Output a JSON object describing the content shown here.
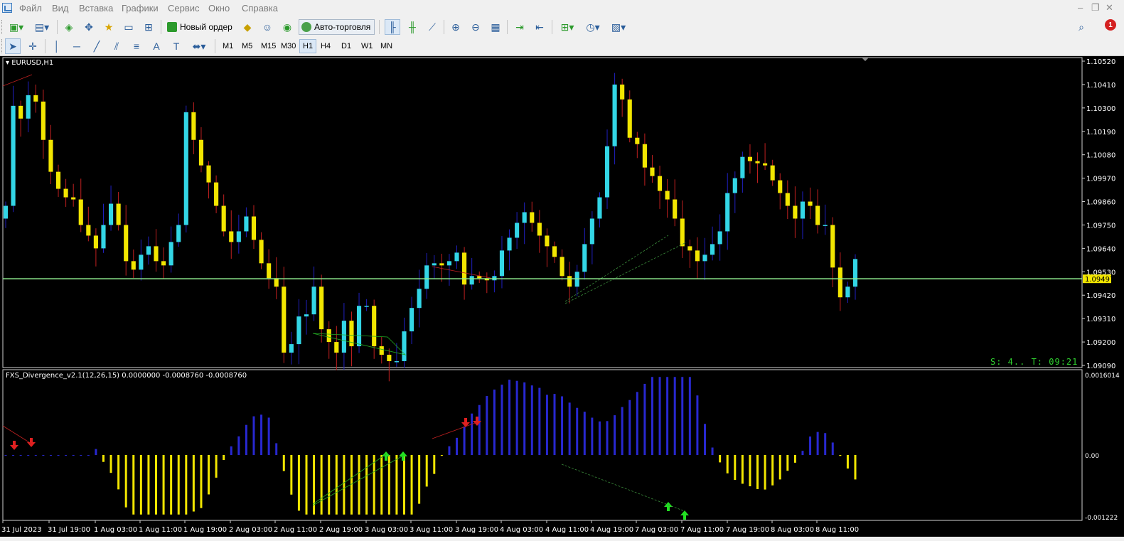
{
  "menu": {
    "items": [
      "Файл",
      "Вид",
      "Вставка",
      "Графики",
      "Сервис",
      "Окно",
      "Справка"
    ]
  },
  "toolbar": {
    "new_order_label": "Новый ордер",
    "autotrading_label": "Авто-торговля"
  },
  "timeframes": [
    "M1",
    "M5",
    "M15",
    "M30",
    "H1",
    "H4",
    "D1",
    "W1",
    "MN"
  ],
  "active_timeframe": "H1",
  "alerts": {
    "count": "1"
  },
  "chart": {
    "symbol_title": "EURUSD,H1",
    "current_price": "1.09497",
    "timer_text": "S: 4.. T: 09:21",
    "price_axis": [
      "1.10520",
      "1.10410",
      "1.10300",
      "1.10190",
      "1.10080",
      "1.09970",
      "1.09860",
      "1.09750",
      "1.09640",
      "1.09530",
      "1.09420",
      "1.09310",
      "1.09200",
      "1.09090"
    ],
    "time_axis": [
      "31 Jul 2023",
      "31 Jul 19:00",
      "1 Aug 03:00",
      "1 Aug 11:00",
      "1 Aug 19:00",
      "2 Aug 03:00",
      "2 Aug 11:00",
      "2 Aug 19:00",
      "3 Aug 03:00",
      "3 Aug 11:00",
      "3 Aug 19:00",
      "4 Aug 03:00",
      "4 Aug 11:00",
      "4 Aug 19:00",
      "7 Aug 03:00",
      "7 Aug 11:00",
      "7 Aug 19:00",
      "8 Aug 03:00",
      "8 Aug 11:00"
    ],
    "colors": {
      "bull": "#33d6e6",
      "bear": "#f2e600",
      "bull_wick": "#2020c0",
      "bear_wick": "#c02020",
      "price_line": "#90ee90"
    }
  },
  "indicator": {
    "title": "FXS_Divergence_v2.1(12,26,15) 0.0000000 -0.0008760 -0.0008760",
    "axis_labels": [
      "0.0016014",
      "0.00",
      "-0.001222"
    ],
    "colors": {
      "positive": "#2828d0",
      "negative": "#f2e600",
      "buy_arrow": "#22e022",
      "sell_arrow": "#e02020"
    }
  },
  "chart_data": {
    "type": "candlestick",
    "symbol": "EURUSD",
    "timeframe": "H1",
    "ylim": [
      1.0909,
      1.1052
    ],
    "close": [
      1.0984,
      1.1031,
      1.1025,
      1.1036,
      1.1033,
      1.1015,
      1.1,
      1.0992,
      1.0988,
      1.0987,
      1.0975,
      1.097,
      1.0964,
      1.0975,
      1.0985,
      1.0975,
      1.0958,
      1.0954,
      1.0961,
      1.0965,
      1.0958,
      1.0956,
      1.0967,
      1.0975,
      1.1028,
      1.1015,
      1.1003,
      1.0995,
      1.0984,
      1.0972,
      1.0967,
      1.0972,
      1.0979,
      1.0968,
      1.0957,
      1.095,
      1.0946,
      1.0915,
      1.0919,
      1.0932,
      1.0933,
      1.0946,
      1.0926,
      1.092,
      1.0915,
      1.093,
      1.0918,
      1.0937,
      1.0937,
      1.0918,
      1.0914,
      1.0911,
      1.0911,
      1.0925,
      1.0936,
      1.0945,
      1.0956,
      1.0957,
      1.0956,
      1.0958,
      1.0962,
      1.0947,
      1.0951,
      1.095,
      1.0949,
      1.0951,
      1.0963,
      1.0969,
      1.0976,
      1.0981,
      1.0976,
      1.097,
      1.0965,
      1.096,
      1.0951,
      1.0946,
      1.0953,
      1.0966,
      1.0978,
      1.0988,
      1.1012,
      1.1041,
      1.1034,
      1.1016,
      1.1013,
      1.1002,
      1.0998,
      1.0991,
      1.0987,
      1.0978,
      1.0965,
      1.0963,
      1.0958,
      1.0961,
      1.0966,
      1.0972,
      1.099,
      1.0997,
      1.1007,
      1.1005,
      1.1004,
      1.1003,
      1.0996,
      1.099,
      1.0984,
      1.0978,
      1.0986,
      1.0984,
      1.0975,
      1.0975,
      1.0955,
      1.0941,
      1.0946,
      1.0959
    ]
  }
}
